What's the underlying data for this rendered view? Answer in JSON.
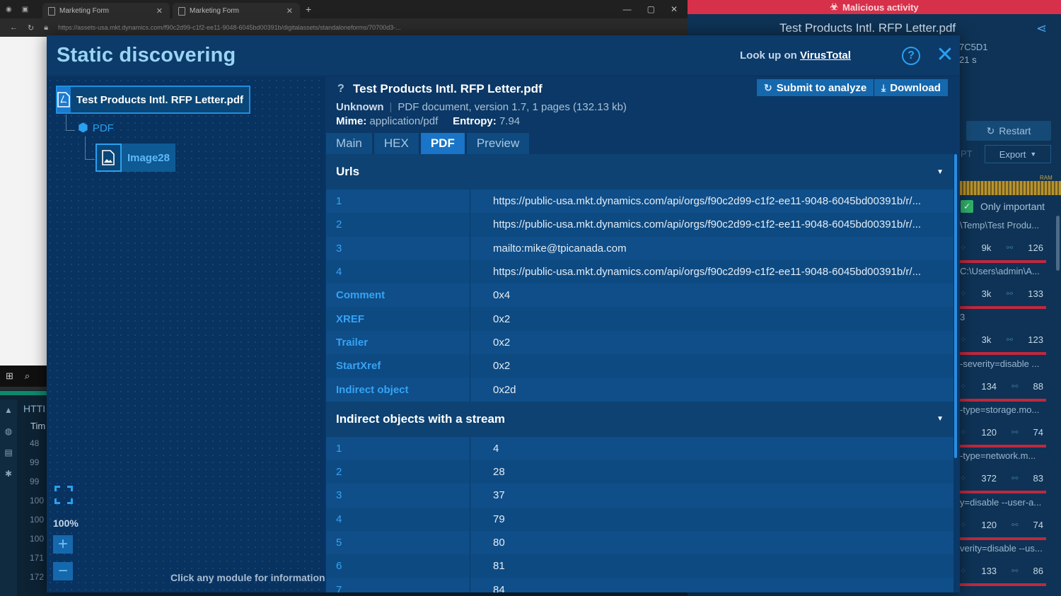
{
  "browser": {
    "tabs": [
      {
        "label": "Marketing Form"
      },
      {
        "label": "Marketing Form"
      }
    ],
    "url": "https://assets-usa.mkt.dynamics.com/f90c2d99-c1f2-ee11-9048-6045bd00391b/digitalassets/standaloneforms/70700d3-..."
  },
  "bg_panel": {
    "alert": "Malicious activity",
    "title": "Test Products Intl. RFP Letter.pdf",
    "hash": "7C5D1",
    "duration": "21 s",
    "restart_label": "Restart",
    "export_label": "Export",
    "pt_label": "PT",
    "ram_label": "RAM",
    "only_important_label": "Only important",
    "processes": [
      {
        "name": "\\Temp\\Test Produ...",
        "a": "9k",
        "b": "126"
      },
      {
        "name": "C:\\Users\\admin\\A...",
        "a": "3k",
        "b": "133"
      },
      {
        "name": "3",
        "a": "3k",
        "b": "123"
      },
      {
        "name": "-severity=disable ...",
        "a": "134",
        "b": "88"
      },
      {
        "name": "-type=storage.mo...",
        "a": "120",
        "b": "74"
      },
      {
        "name": "-type=network.m...",
        "a": "372",
        "b": "83"
      },
      {
        "name": "y=disable --user-a...",
        "a": "120",
        "b": "74"
      },
      {
        "name": "verity=disable --us...",
        "a": "133",
        "b": "86"
      }
    ]
  },
  "bg_bottom": {
    "column_label": "HTTI",
    "time_label": "Tim",
    "numbers": [
      "48",
      "99",
      "99",
      "100",
      "100",
      "100",
      "171",
      "172"
    ]
  },
  "modal": {
    "title": "Static discovering",
    "lookup_prefix": "Look up on ",
    "lookup_link": "VirusTotal",
    "tree": {
      "root_label": "Test Products Intl. RFP Letter.pdf",
      "child_label": "PDF",
      "grandchild_label": "Image28"
    },
    "zoom_level": "100%",
    "hint": "Click any module for information",
    "file": {
      "question": "?",
      "name": "Test Products Intl. RFP Letter.pdf",
      "verdict": "Unknown",
      "description": "PDF document, version 1.7, 1 pages (132.13 kb)",
      "mime_label": "Mime:",
      "mime_value": "application/pdf",
      "entropy_label": "Entropy:",
      "entropy_value": "7.94"
    },
    "buttons": {
      "submit": "Submit to analyze",
      "download": "Download"
    },
    "tabs": [
      "Main",
      "HEX",
      "PDF",
      "Preview"
    ],
    "active_tab": "PDF",
    "sections": [
      {
        "title": "Urls",
        "rows": [
          {
            "key": "1",
            "value": "https://public-usa.mkt.dynamics.com/api/orgs/f90c2d99-c1f2-ee11-9048-6045bd00391b/r/..."
          },
          {
            "key": "2",
            "value": "https://public-usa.mkt.dynamics.com/api/orgs/f90c2d99-c1f2-ee11-9048-6045bd00391b/r/..."
          },
          {
            "key": "3",
            "value": "mailto:mike@tpicanada.com"
          },
          {
            "key": "4",
            "value": "https://public-usa.mkt.dynamics.com/api/orgs/f90c2d99-c1f2-ee11-9048-6045bd00391b/r/..."
          },
          {
            "key": "Comment",
            "value": "0x4"
          },
          {
            "key": "XREF",
            "value": "0x2"
          },
          {
            "key": "Trailer",
            "value": "0x2"
          },
          {
            "key": "StartXref",
            "value": "0x2"
          },
          {
            "key": "Indirect object",
            "value": "0x2d"
          }
        ]
      },
      {
        "title": "Indirect objects with a stream",
        "rows": [
          {
            "key": "1",
            "value": "4"
          },
          {
            "key": "2",
            "value": "28"
          },
          {
            "key": "3",
            "value": "37"
          },
          {
            "key": "4",
            "value": "79"
          },
          {
            "key": "5",
            "value": "80"
          },
          {
            "key": "6",
            "value": "81"
          },
          {
            "key": "7",
            "value": "84"
          }
        ]
      }
    ]
  }
}
